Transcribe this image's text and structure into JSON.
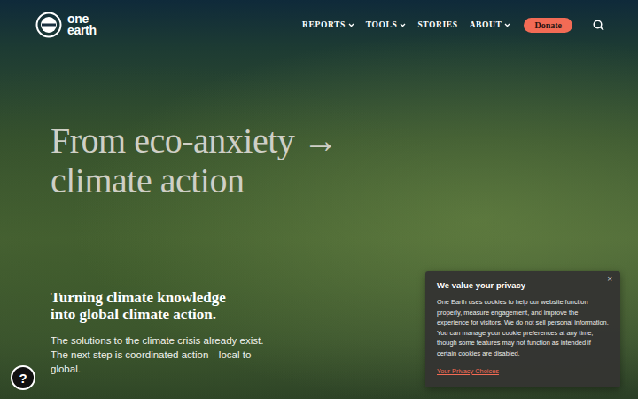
{
  "nav": {
    "logo": [
      "one",
      "earth"
    ],
    "items": [
      {
        "label": "REPORTS",
        "kind": "dropdown"
      },
      {
        "label": "TOOLS",
        "kind": "dropdown"
      },
      {
        "label": "STORIES",
        "kind": "link"
      },
      {
        "label": "ABOUT",
        "kind": "dropdown"
      }
    ],
    "donate": "Donate"
  },
  "hero": {
    "headline": [
      "From eco-anxiety →",
      "climate action"
    ],
    "subheading": [
      "Turning climate knowledge",
      "into global climate action."
    ],
    "paragraph": [
      "The solutions to the climate crisis already exist.",
      "The next step is coordinated action—local to",
      "global."
    ]
  },
  "help": "?",
  "cookie": {
    "close": "×",
    "title": "We value your privacy",
    "text": "One Earth uses cookies to help our website function properly, measure engagement, and improve the experience for visitors. We do not sell personal information. You can manage your cookie preferences at any time, though some features may not function as intended if certain cookies are disabled.",
    "link": "Your Privacy Choices"
  }
}
